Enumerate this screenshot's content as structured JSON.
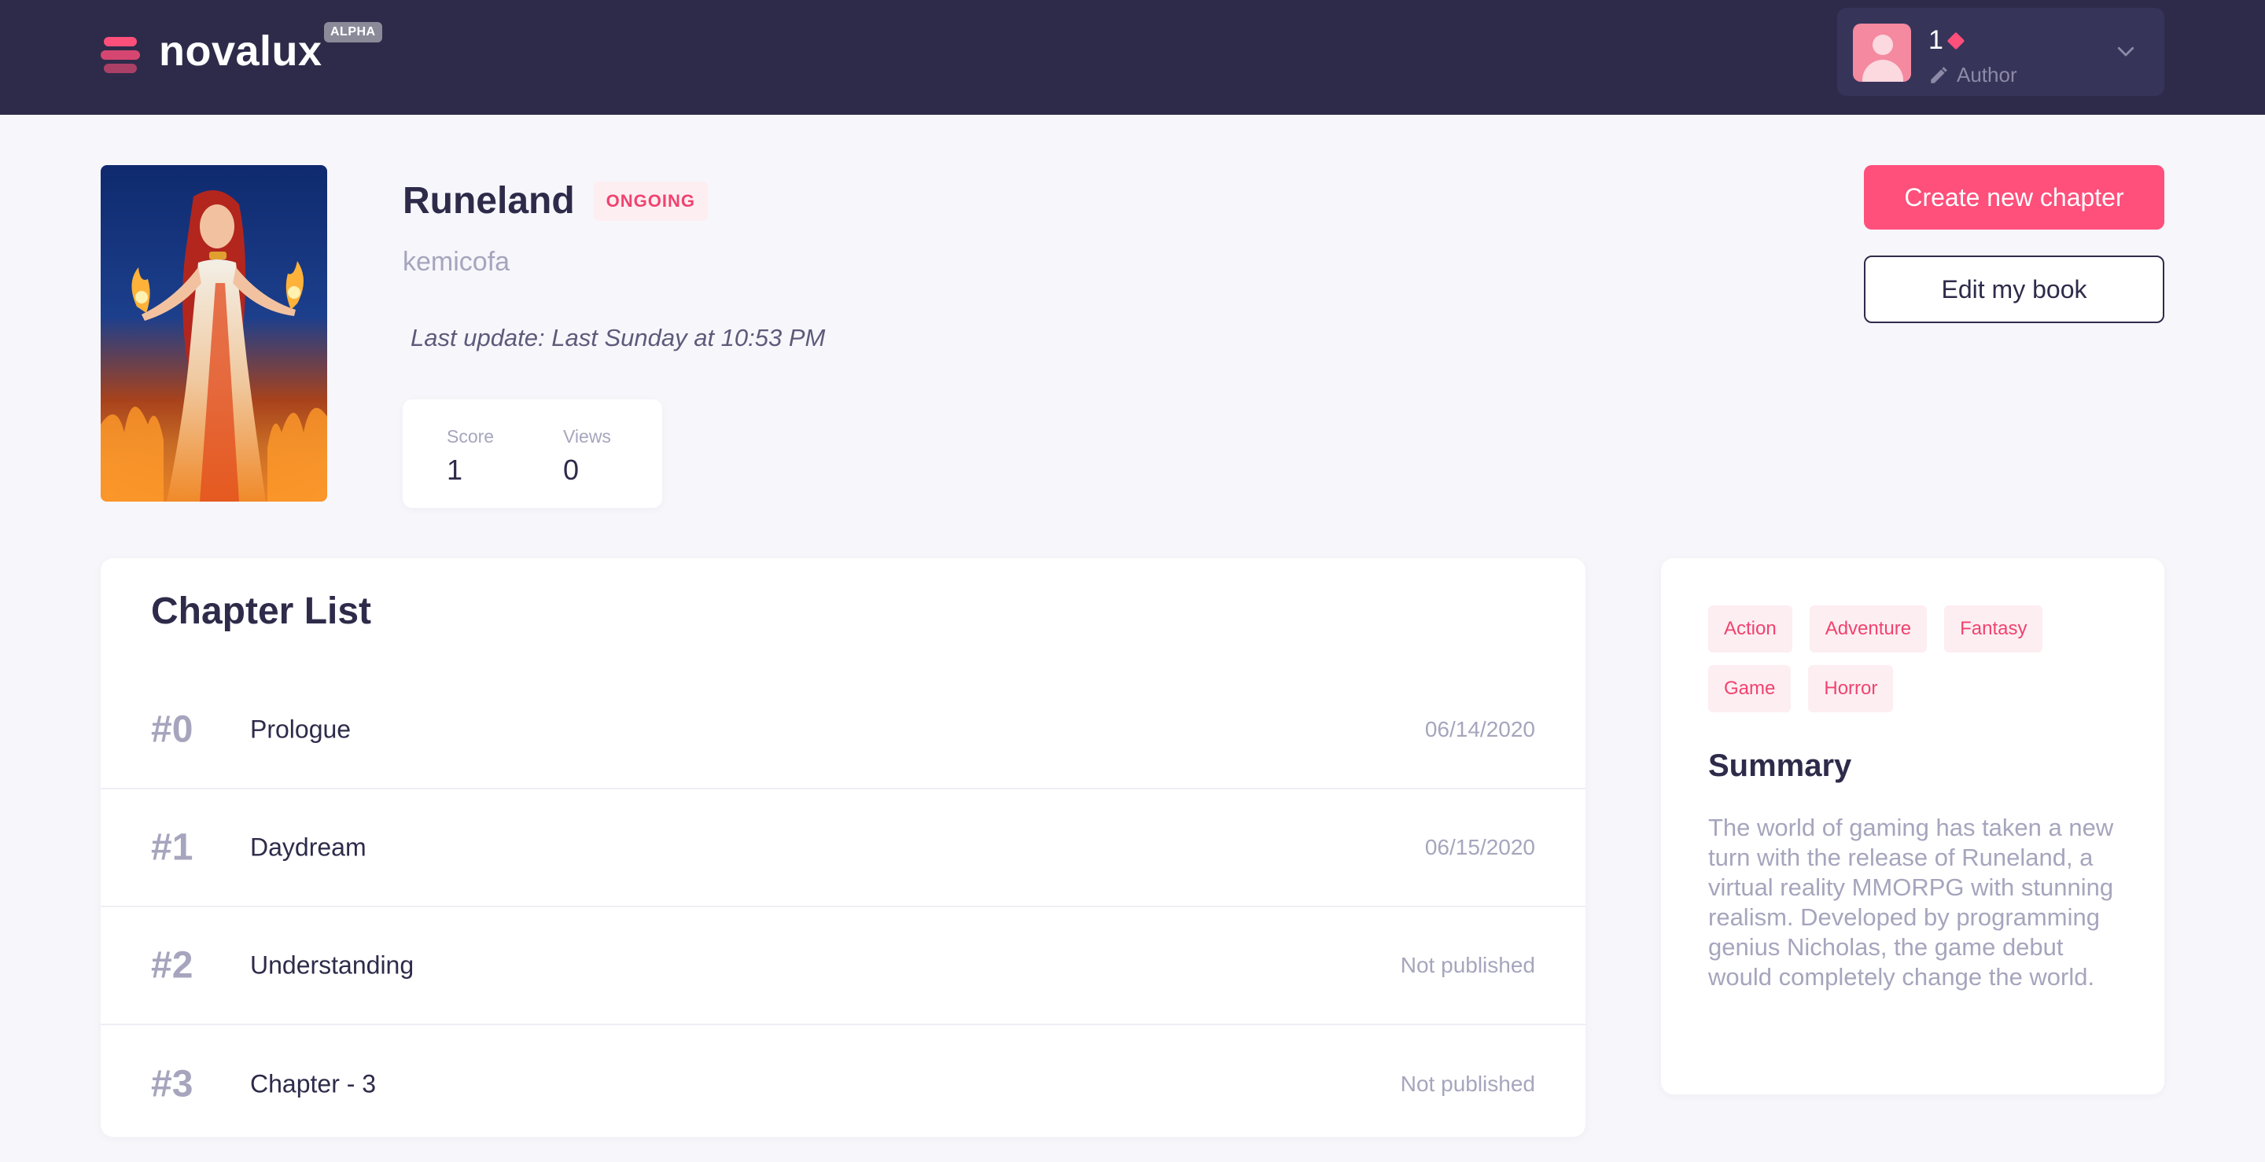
{
  "header": {
    "logo_text": "novalux",
    "badge": "ALPHA",
    "user": {
      "points": "1",
      "role": "Author"
    }
  },
  "book": {
    "title": "Runeland",
    "status": "ONGOING",
    "author": "kemicofa",
    "last_update": "Last update: Last Sunday at 10:53 PM",
    "stats": [
      {
        "label": "Score",
        "value": "1"
      },
      {
        "label": "Views",
        "value": "0"
      }
    ]
  },
  "actions": {
    "create_chapter": "Create new chapter",
    "edit_book": "Edit my book"
  },
  "chapters": {
    "heading": "Chapter List",
    "items": [
      {
        "number": "#0",
        "title": "Prologue",
        "date": "06/14/2020"
      },
      {
        "number": "#1",
        "title": "Daydream",
        "date": "06/15/2020"
      },
      {
        "number": "#2",
        "title": "Understanding",
        "date": "Not published"
      },
      {
        "number": "#3",
        "title": "Chapter - 3",
        "date": "Not published"
      }
    ]
  },
  "sidebar": {
    "tags": [
      "Action",
      "Adventure",
      "Fantasy",
      "Game",
      "Horror"
    ],
    "summary_heading": "Summary",
    "summary_text": "The world of gaming has taken a new turn with the release of Runeland, a virtual reality MMORPG with stunning realism. Developed by programming genius Nicholas, the game debut would completely change the world."
  },
  "icons": {
    "logo": "stack-logo-icon",
    "diamond": "diamond-icon",
    "pencil": "pencil-icon",
    "chevron": "chevron-down-icon"
  },
  "colors": {
    "accent": "#ff4f7b",
    "header_bg": "#2e2b4a",
    "page_bg": "#f7f6fb",
    "muted_text": "#a6a5bd"
  }
}
